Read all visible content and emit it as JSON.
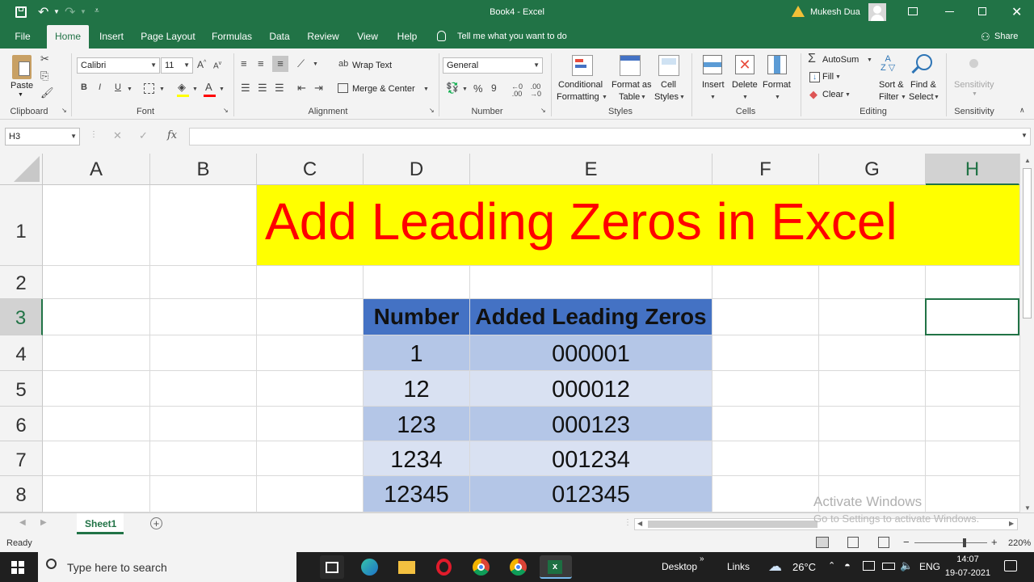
{
  "window": {
    "title": "Book4  -  Excel",
    "user": "Mukesh Dua"
  },
  "tabs": [
    "File",
    "Home",
    "Insert",
    "Page Layout",
    "Formulas",
    "Data",
    "Review",
    "View",
    "Help"
  ],
  "tell_me": "Tell me what you want to do",
  "share": "Share",
  "ribbon": {
    "clipboard": {
      "paste": "Paste",
      "group": "Clipboard"
    },
    "font": {
      "name": "Calibri",
      "size": "11",
      "group": "Font",
      "bold": "B",
      "italic": "I",
      "underline": "U"
    },
    "alignment": {
      "wrap": "Wrap Text",
      "merge": "Merge & Center",
      "group": "Alignment"
    },
    "number": {
      "format": "General",
      "group": "Number",
      "percent": "%",
      "comma": "9"
    },
    "styles": {
      "cond1": "Conditional",
      "cond2": "Formatting",
      "table1": "Format as",
      "table2": "Table",
      "cell1": "Cell",
      "cell2": "Styles",
      "group": "Styles"
    },
    "cells": {
      "insert": "Insert",
      "delete": "Delete",
      "format": "Format",
      "group": "Cells"
    },
    "editing": {
      "autosum": "AutoSum",
      "fill": "Fill",
      "clear": "Clear",
      "sort1": "Sort &",
      "sort2": "Filter",
      "find1": "Find &",
      "find2": "Select",
      "group": "Editing"
    },
    "sensitivity": {
      "label": "Sensitivity",
      "group": "Sensitivity"
    }
  },
  "formula_bar": {
    "name_box": "H3",
    "fx": "fx",
    "value": ""
  },
  "columns": [
    "A",
    "B",
    "C",
    "D",
    "E",
    "F",
    "G",
    "H"
  ],
  "rows": [
    "1",
    "2",
    "3",
    "4",
    "5",
    "6",
    "7",
    "8"
  ],
  "sheet": {
    "title": "Add Leading Zeros in Excel",
    "headers": [
      "Number",
      "Added Leading Zeros"
    ],
    "data": [
      [
        "1",
        "000001"
      ],
      [
        "12",
        "000012"
      ],
      [
        "123",
        "000123"
      ],
      [
        "1234",
        "001234"
      ],
      [
        "12345",
        "012345"
      ]
    ]
  },
  "sheet_tab": "Sheet1",
  "status": {
    "ready": "Ready",
    "zoom": "220%"
  },
  "watermark": {
    "line1": "Activate Windows",
    "line2": "Go to Settings to activate Windows."
  },
  "taskbar": {
    "search": "Type here to search",
    "desktop": "Desktop",
    "links": "Links",
    "temp": "26°C",
    "lang": "ENG",
    "time": "14:07",
    "date": "19-07-2021"
  },
  "colors": {
    "excel_green": "#217346",
    "title_fill": "#ffff00",
    "title_text": "#ff0000",
    "header_fill": "#4472c4",
    "band_dark": "#b4c6e7",
    "band_light": "#d9e1f2"
  }
}
